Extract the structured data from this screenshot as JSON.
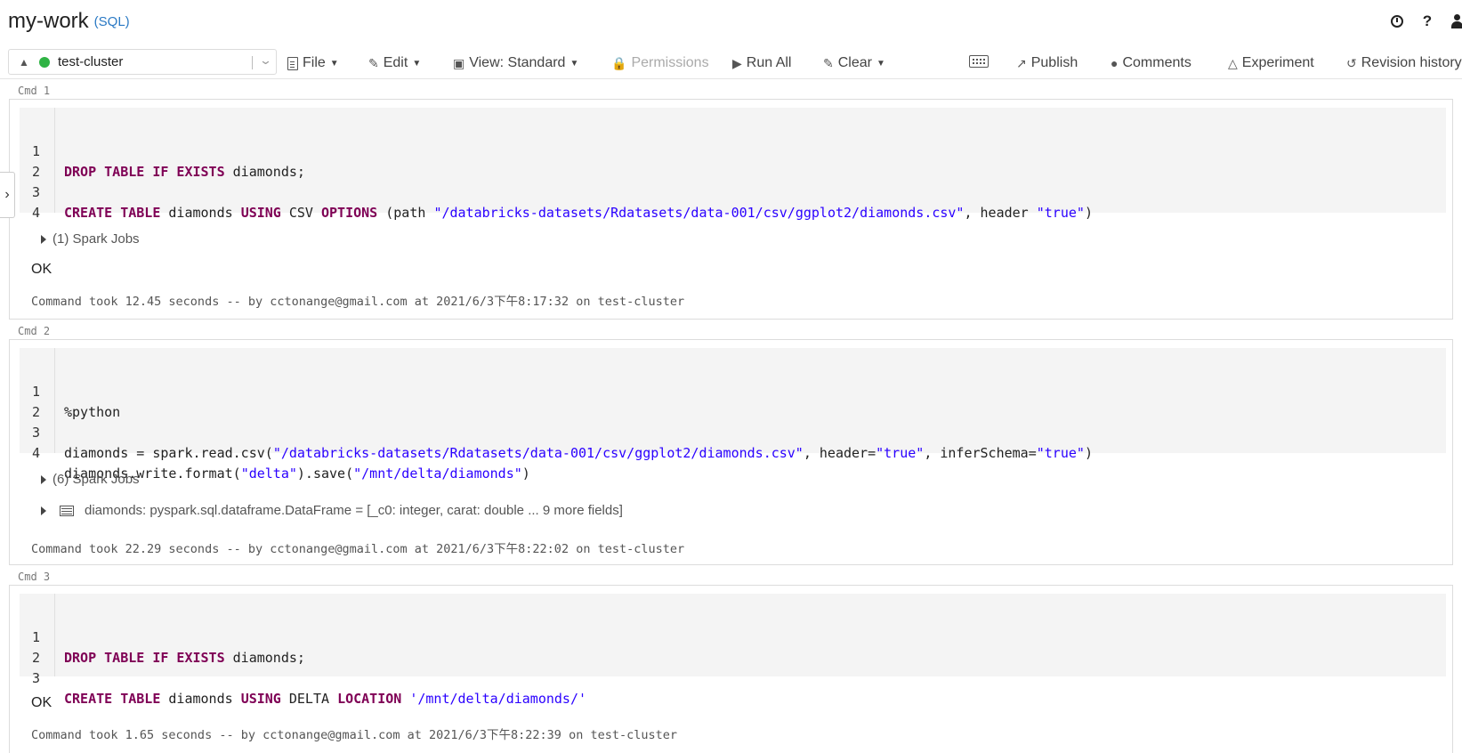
{
  "header": {
    "title": "my-work",
    "language": "(SQL)"
  },
  "toolbar": {
    "cluster": "test-cluster",
    "file": "File",
    "edit": "Edit",
    "view": "View: Standard",
    "permissions": "Permissions",
    "run_all": "Run All",
    "clear": "Clear",
    "publish": "Publish",
    "comments": "Comments",
    "experiment": "Experiment",
    "revision_history": "Revision history"
  },
  "cells": [
    {
      "label": "Cmd 1",
      "lines": [
        "1",
        "2",
        "3",
        "4"
      ],
      "spark_jobs": "(1) Spark Jobs",
      "result": "OK",
      "took": "Command took 12.45 seconds -- by cctonange@gmail.com at 2021/6/3下午8:17:32 on test-cluster"
    },
    {
      "label": "Cmd 2",
      "lines": [
        "1",
        "2",
        "3",
        "4"
      ],
      "spark_jobs": "(6) Spark Jobs",
      "df_name": "diamonds:",
      "df_type": "pyspark.sql.dataframe.DataFrame = [_c0: integer, carat: double ... 9 more fields]",
      "took": "Command took 22.29 seconds -- by cctonange@gmail.com at 2021/6/3下午8:22:02 on test-cluster"
    },
    {
      "label": "Cmd 3",
      "lines": [
        "1",
        "2",
        "3"
      ],
      "result": "OK",
      "took": "Command took 1.65 seconds -- by cctonange@gmail.com at 2021/6/3下午8:22:39 on test-cluster"
    }
  ],
  "code": {
    "c1_l1": [
      "DROP TABLE IF EXISTS",
      " diamonds;"
    ],
    "c1_l3": [
      "CREATE TABLE",
      " diamonds ",
      "USING",
      " CSV ",
      "OPTIONS",
      " (path ",
      "\"/databricks-datasets/Rdatasets/data-001/csv/ggplot2/diamonds.csv\"",
      ", header ",
      "\"true\"",
      ")"
    ],
    "c2_l1": "%python",
    "c2_l3": [
      "diamonds = spark.read.csv(",
      "\"/databricks-datasets/Rdatasets/data-001/csv/ggplot2/diamonds.csv\"",
      ", header=",
      "\"true\"",
      ", inferSchema=",
      "\"true\"",
      ")"
    ],
    "c2_l4": [
      "diamonds.write.format(",
      "\"delta\"",
      ").save(",
      "\"/mnt/delta/diamonds\"",
      ")"
    ],
    "c3_l1": [
      "DROP TABLE IF EXISTS",
      " diamonds;"
    ],
    "c3_l3": [
      "CREATE TABLE",
      " diamonds ",
      "USING",
      " DELTA ",
      "LOCATION",
      " ",
      "'/mnt/delta/diamonds/'"
    ]
  }
}
